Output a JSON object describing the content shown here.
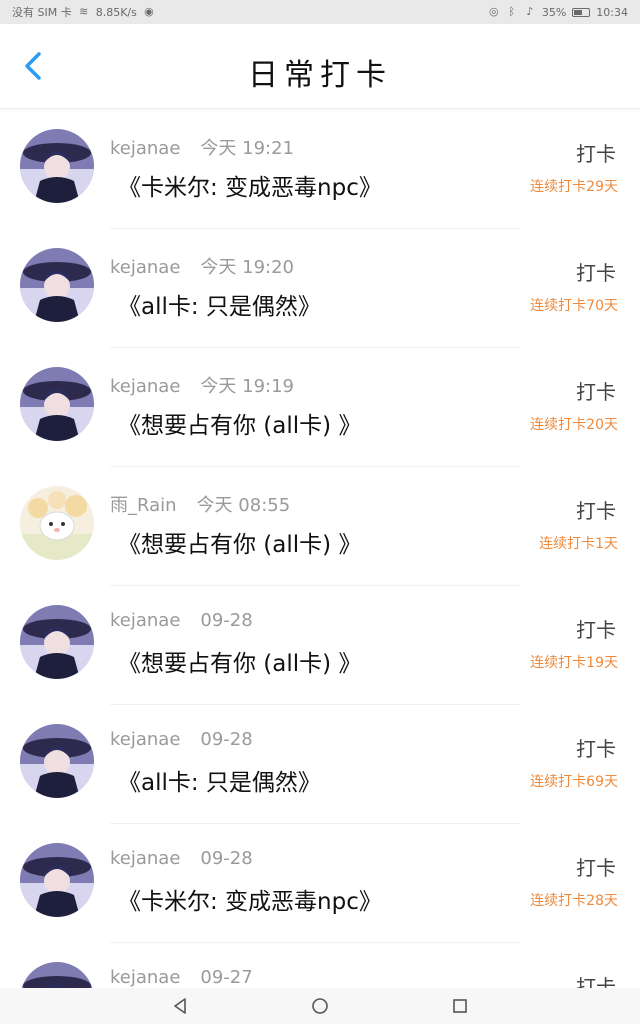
{
  "status_bar": {
    "carrier": "没有 SIM 卡",
    "speed": "8.85K/s",
    "battery": "35%",
    "time": "10:34"
  },
  "header": {
    "title": "日常打卡"
  },
  "items": [
    {
      "user": "kejanae",
      "time": "今天 19:21",
      "book": "《卡米尔: 变成恶毒npc》",
      "action": "打卡",
      "streak": "连续打卡29天",
      "avatar": "anime-avatar"
    },
    {
      "user": "kejanae",
      "time": "今天 19:20",
      "book": "《all卡: 只是偶然》",
      "action": "打卡",
      "streak": "连续打卡70天",
      "avatar": "anime-avatar"
    },
    {
      "user": "kejanae",
      "time": "今天 19:19",
      "book": "《想要占有你 (all卡) 》",
      "action": "打卡",
      "streak": "连续打卡20天",
      "avatar": "anime-avatar"
    },
    {
      "user": "雨_Rain",
      "time": "今天 08:55",
      "book": "《想要占有你 (all卡) 》",
      "action": "打卡",
      "streak": "连续打卡1天",
      "avatar": "bunny-avatar"
    },
    {
      "user": "kejanae",
      "time": "09-28",
      "book": "《想要占有你 (all卡) 》",
      "action": "打卡",
      "streak": "连续打卡19天",
      "avatar": "anime-avatar"
    },
    {
      "user": "kejanae",
      "time": "09-28",
      "book": "《all卡: 只是偶然》",
      "action": "打卡",
      "streak": "连续打卡69天",
      "avatar": "anime-avatar"
    },
    {
      "user": "kejanae",
      "time": "09-28",
      "book": "《卡米尔: 变成恶毒npc》",
      "action": "打卡",
      "streak": "连续打卡28天",
      "avatar": "anime-avatar"
    },
    {
      "user": "kejanae",
      "time": "09-27",
      "book": "",
      "action": "打卡",
      "streak": "",
      "avatar": "anime-avatar"
    }
  ],
  "colors": {
    "accent": "#2b9cf2",
    "streak": "#ef8a3c"
  },
  "nav": {
    "back": "back-triangle-icon",
    "home": "home-circle-icon",
    "recent": "recent-square-icon"
  }
}
